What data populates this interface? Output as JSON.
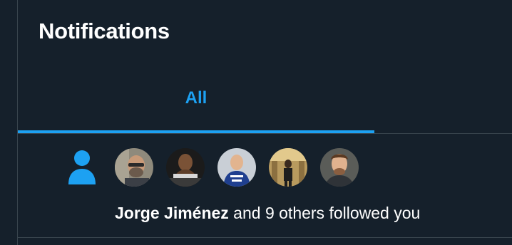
{
  "header": {
    "title": "Notifications"
  },
  "tabs": [
    {
      "label": "All",
      "active": true
    }
  ],
  "notification": {
    "type_icon": "person-follow-icon",
    "avatars": [
      {
        "icon": "avatar-photo"
      },
      {
        "icon": "avatar-photo"
      },
      {
        "icon": "avatar-photo"
      },
      {
        "icon": "avatar-photo"
      },
      {
        "icon": "avatar-photo"
      }
    ],
    "actor": "Jorge Jiménez",
    "message": " and 9 others followed you"
  },
  "colors": {
    "background": "#15202b",
    "accent": "#1da1f2",
    "divider": "#38444d",
    "text": "#ffffff"
  }
}
